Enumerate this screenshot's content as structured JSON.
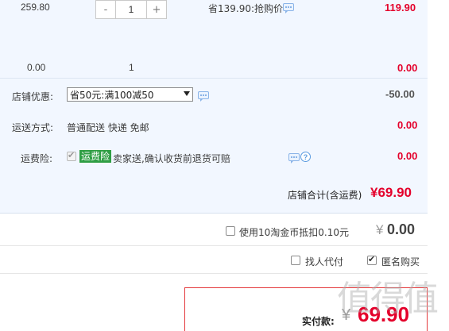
{
  "item_row": {
    "unit_price": "259.80",
    "quantity": "1",
    "minus_label": "-",
    "plus_label": "+",
    "promo_text": "省139.90:抢购价",
    "subtotal": "119.90"
  },
  "summary_row": {
    "price": "0.00",
    "quantity": "1",
    "subtotal": "0.00"
  },
  "shop_discount": {
    "label": "店铺优惠:",
    "selected_option": "省50元:满100减50",
    "amount": "-50.00"
  },
  "shipping": {
    "label": "运送方式:",
    "value": "普通配送 快递 免邮",
    "amount": "0.00"
  },
  "shipping_insurance": {
    "label": "运费险:",
    "tag": "运费险",
    "description": "卖家送,确认收货前退货可赔",
    "amount": "0.00",
    "checked": true
  },
  "shop_total": {
    "label": "店铺合计(含运费)",
    "amount": "¥69.90"
  },
  "taobao_coins": {
    "label": "使用10淘金币抵扣0.10元",
    "currency": "¥",
    "amount": "0.00",
    "checked": false
  },
  "options": {
    "proxy_pay_label": "找人代付",
    "proxy_pay_checked": false,
    "anonymous_label": "匿名购买",
    "anonymous_checked": true
  },
  "payment": {
    "label": "实付款:",
    "currency": "¥",
    "amount": "69.90"
  },
  "watermark": "值得值",
  "colors": {
    "accent_red": "#e4002b",
    "panel_blue": "#f2f7ff",
    "tag_green": "#2f9e44",
    "link_blue": "#5b9be0"
  }
}
